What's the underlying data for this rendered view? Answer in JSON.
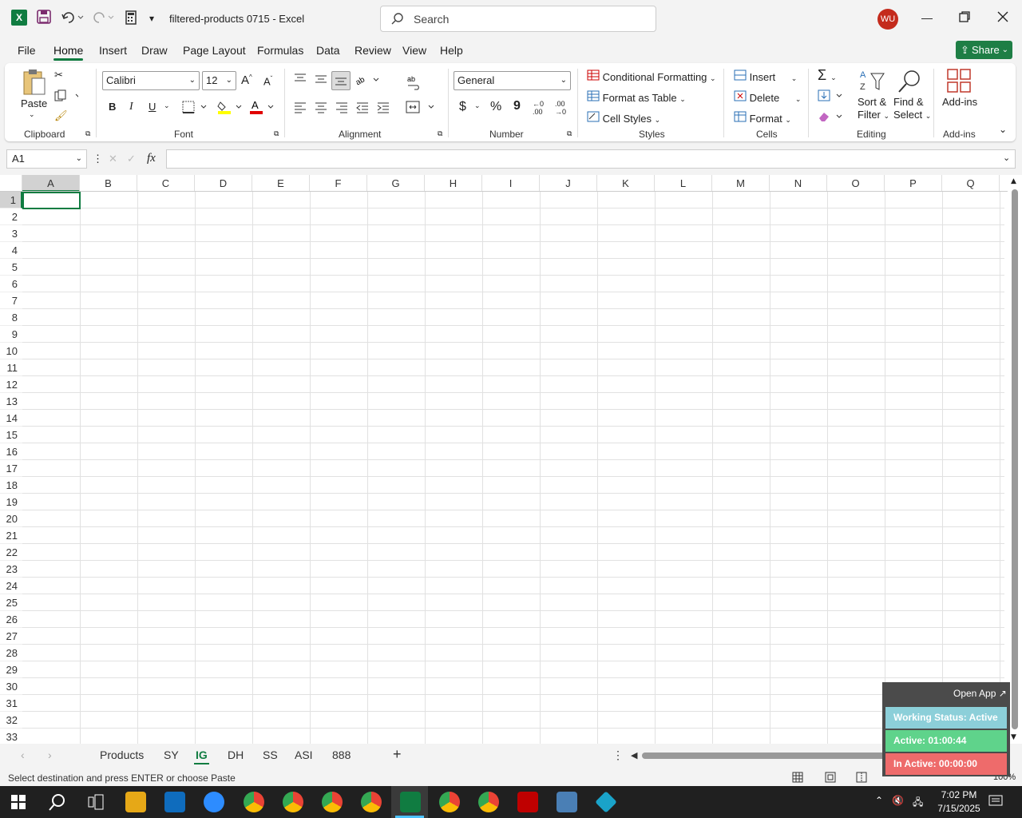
{
  "window": {
    "title": "filtered-products 0715  -  Excel",
    "avatar_initials": "WU",
    "search_placeholder": "Search"
  },
  "menu": [
    "File",
    "Home",
    "Insert",
    "Draw",
    "Page Layout",
    "Formulas",
    "Data",
    "Review",
    "View",
    "Help"
  ],
  "share_label": "Share",
  "ribbon": {
    "clipboard": {
      "paste": "Paste",
      "label": "Clipboard"
    },
    "font": {
      "name": "Calibri",
      "size": "12",
      "label": "Font",
      "bold": "B",
      "italic": "I",
      "underline": "U"
    },
    "alignment": {
      "label": "Alignment"
    },
    "number": {
      "format": "General",
      "label": "Number",
      "currency": "$",
      "percent": "%",
      "comma": "9"
    },
    "styles": {
      "conditional": "Conditional Formatting",
      "table": "Format as Table",
      "cell": "Cell Styles",
      "label": "Styles"
    },
    "cells": {
      "insert": "Insert",
      "delete": "Delete",
      "format": "Format",
      "label": "Cells"
    },
    "editing": {
      "sort1": "Sort &",
      "sort2": "Filter",
      "find1": "Find &",
      "find2": "Select",
      "label": "Editing"
    },
    "addins": {
      "btn": "Add-ins",
      "label": "Add-ins"
    }
  },
  "namebox": "A1",
  "fx": "fx",
  "columns": [
    "A",
    "B",
    "C",
    "D",
    "E",
    "F",
    "G",
    "H",
    "I",
    "J",
    "K",
    "L",
    "M",
    "N",
    "O",
    "P",
    "Q"
  ],
  "rows": [
    "1",
    "2",
    "3",
    "4",
    "5",
    "6",
    "7",
    "8",
    "9",
    "10",
    "11",
    "12",
    "13",
    "14",
    "15",
    "16",
    "17",
    "18",
    "19",
    "20",
    "21",
    "22",
    "23",
    "24",
    "25",
    "26",
    "27",
    "28",
    "29",
    "30",
    "31",
    "32",
    "33"
  ],
  "sheets": [
    "Products",
    "SY",
    "IG",
    "DH",
    "SS",
    "ASI",
    "888"
  ],
  "active_sheet": "IG",
  "status": "Select destination and press ENTER or choose Paste",
  "zoom": "100%",
  "overlay": {
    "open": "Open App ↗",
    "working": "Working Status: Active",
    "active": "Active: 01:00:44",
    "inactive": "In Active: 00:00:00"
  },
  "clock": {
    "time": "7:02 PM",
    "date": "7/15/2025"
  },
  "colors": {
    "accent": "#107c41",
    "working": "#8ccfd9",
    "active": "#5fd38b",
    "inactive": "#ee6b6b"
  }
}
